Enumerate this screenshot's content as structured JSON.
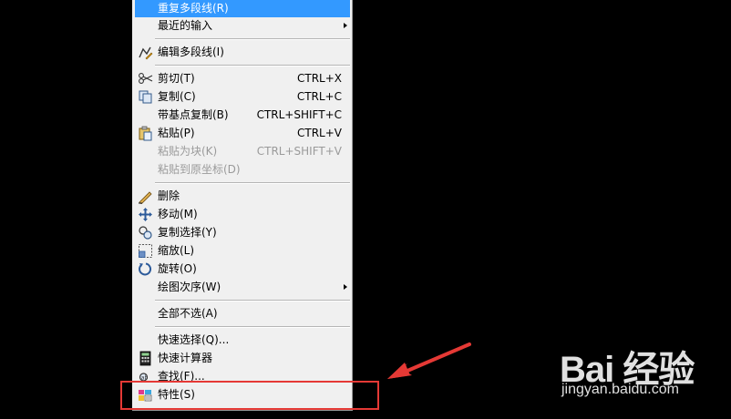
{
  "menu": {
    "items": [
      {
        "label": "重复多段线(R)",
        "highlight": true
      },
      {
        "label": "最近的输入",
        "submenu": true
      },
      {
        "label": "编辑多段线(I)",
        "icon": "edit-polyline-icon"
      },
      {
        "label": "剪切(T)",
        "shortcut": "CTRL+X",
        "icon": "scissors-icon"
      },
      {
        "label": "复制(C)",
        "shortcut": "CTRL+C",
        "icon": "copy-icon"
      },
      {
        "label": "带基点复制(B)",
        "shortcut": "CTRL+SHIFT+C"
      },
      {
        "label": "粘贴(P)",
        "shortcut": "CTRL+V",
        "icon": "paste-icon"
      },
      {
        "label": "粘贴为块(K)",
        "shortcut": "CTRL+SHIFT+V",
        "disabled": true
      },
      {
        "label": "粘贴到原坐标(D)",
        "disabled": true
      },
      {
        "label": "删除",
        "icon": "eraser-icon"
      },
      {
        "label": "移动(M)",
        "icon": "move-icon"
      },
      {
        "label": "复制选择(Y)",
        "icon": "copy-selection-icon"
      },
      {
        "label": "缩放(L)",
        "icon": "scale-icon"
      },
      {
        "label": "旋转(O)",
        "icon": "rotate-icon"
      },
      {
        "label": "绘图次序(W)",
        "submenu": true
      },
      {
        "label": "全部不选(A)"
      },
      {
        "label": "快速选择(Q)...",
        "icon": "quick-select-icon"
      },
      {
        "label": "快速计算器",
        "icon": "calculator-icon"
      },
      {
        "label": "查找(F)...",
        "icon": "find-icon"
      },
      {
        "label": "特性(S)",
        "icon": "properties-icon"
      }
    ]
  },
  "watermark": {
    "logo": "Bai 经验",
    "url": "jingyan.baidu.com"
  },
  "colors": {
    "highlight": "#3399ff",
    "annotation": "#e53935"
  }
}
